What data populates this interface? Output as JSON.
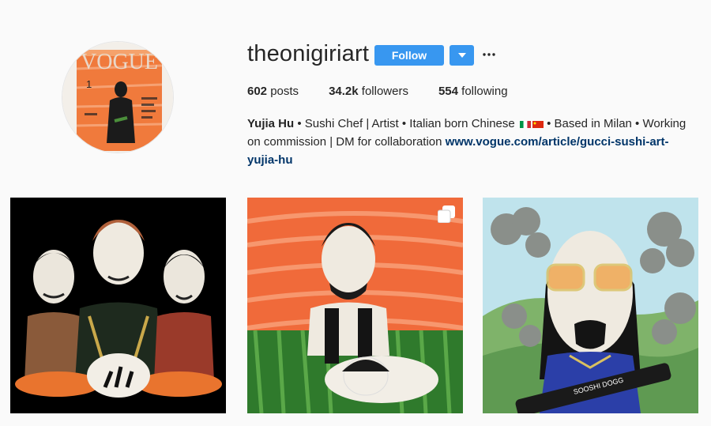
{
  "profile": {
    "username": "theonigiriart",
    "avatar_icon": "vogue-cover-avatar",
    "avatar_text": "VOGUE"
  },
  "actions": {
    "follow_label": "Follow",
    "dropdown_icon": "caret-down-icon",
    "more_icon": "ellipsis-icon"
  },
  "stats": {
    "posts_count": "602",
    "posts_label": "posts",
    "followers_count": "34.2k",
    "followers_label": "followers",
    "following_count": "554",
    "following_label": "following"
  },
  "bio": {
    "name": "Yujia Hu",
    "text_1": " • Sushi Chef | Artist • Italian born Chinese ",
    "text_2": "• Based in Milan • Working on commission | DM for collaboration ",
    "link": "www.vogue.com/article/gucci-sushi-art-yujia-hu",
    "flags": [
      "italy-flag-icon",
      "china-flag-icon"
    ]
  },
  "posts": [
    {
      "subject": "three rice-ball rappers on black background",
      "icon": "none"
    },
    {
      "subject": "rice figure on salmon background",
      "icon": "multiple-posts-icon"
    },
    {
      "subject": "rice figure with sunglasses and smoke clouds",
      "icon": "none",
      "text": "SOOSHI DOGG"
    }
  ],
  "colors": {
    "accent": "#3897f0",
    "link": "#003569",
    "text": "#262626",
    "background": "#fafafa"
  }
}
